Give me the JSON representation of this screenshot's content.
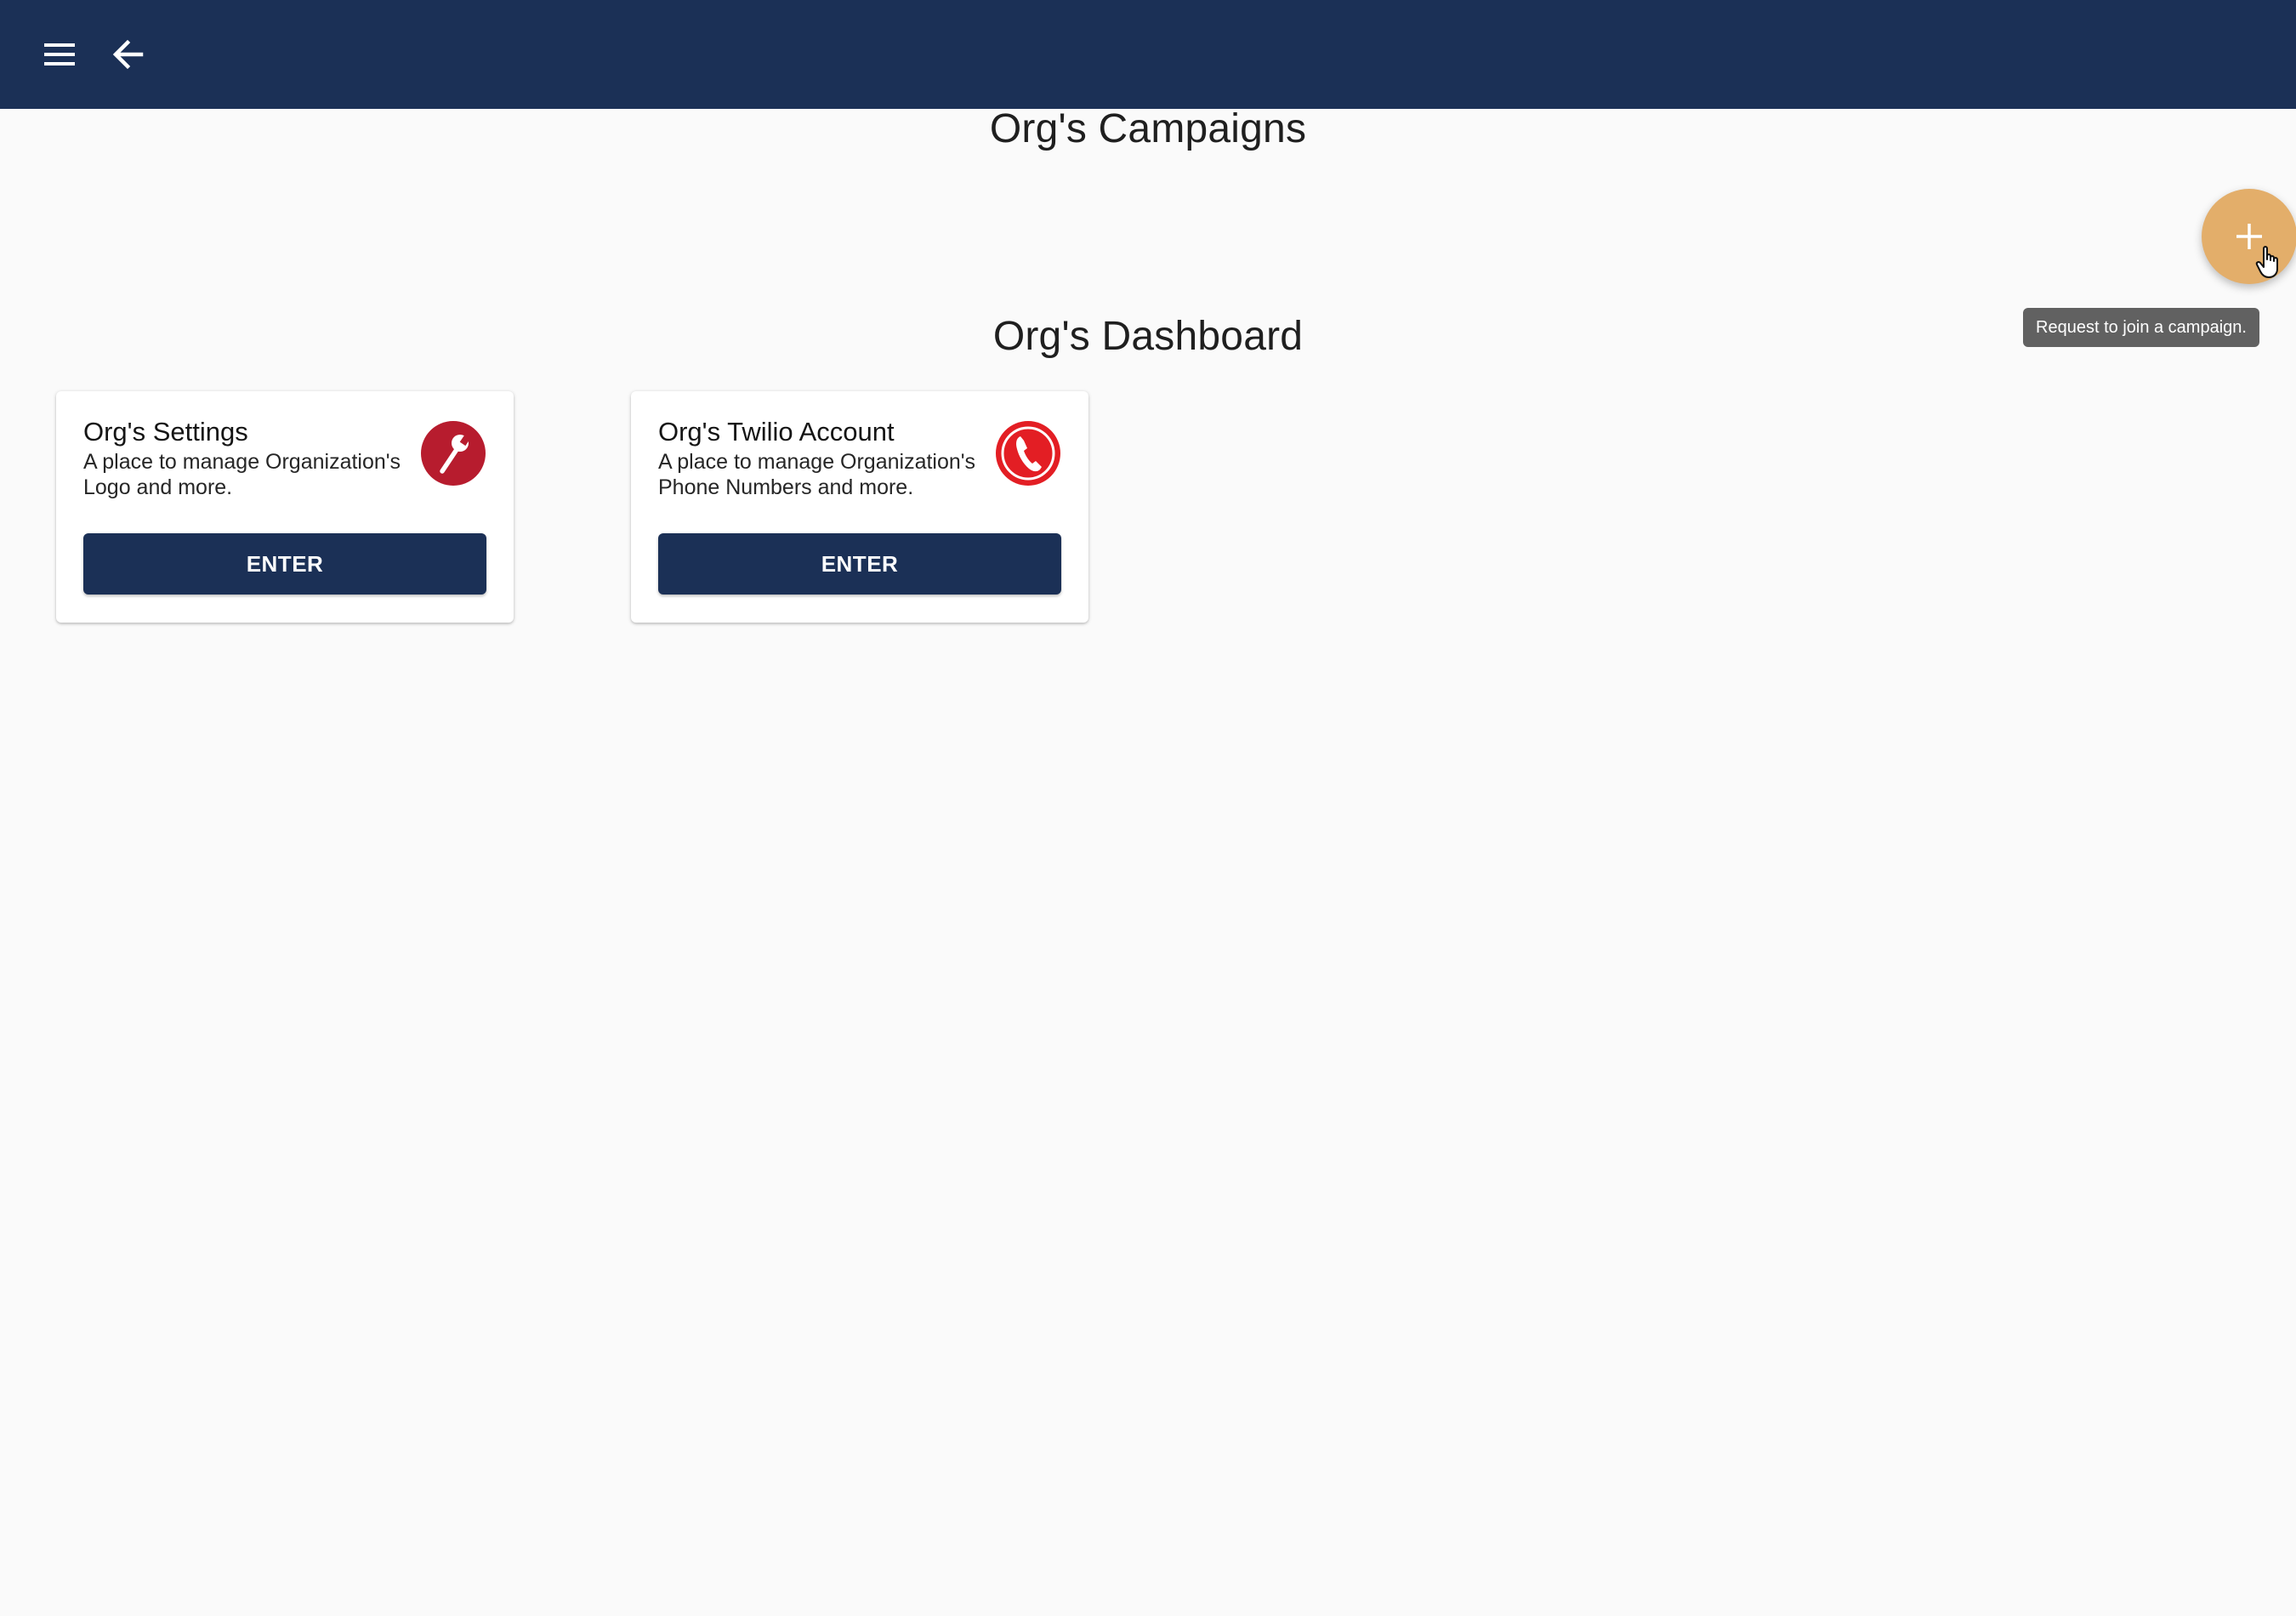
{
  "app_bar": {
    "menu_icon": "hamburger-menu-icon",
    "back_icon": "arrow-left-icon",
    "background_color": "#1b3056"
  },
  "campaigns": {
    "title": "Org's Campaigns"
  },
  "fab": {
    "icon": "plus-icon",
    "color": "#e3ae6a",
    "tooltip": "Request to join a campaign."
  },
  "dashboard": {
    "title": "Org's Dashboard",
    "cards": [
      {
        "title": "Org's Settings",
        "description": "A place to manage Organization's Logo and more.",
        "icon": "wrench-icon",
        "button_label": "ENTER"
      },
      {
        "title": "Org's Twilio Account",
        "description": "A place to manage Organization's Phone Numbers and more.",
        "icon": "phone-icon",
        "button_label": "ENTER"
      }
    ]
  },
  "colors": {
    "primary": "#1b3056",
    "accent": "#e3ae6a",
    "icon_red": "#b71c2e",
    "phone_red": "#e31e24",
    "background": "#fafafa"
  }
}
